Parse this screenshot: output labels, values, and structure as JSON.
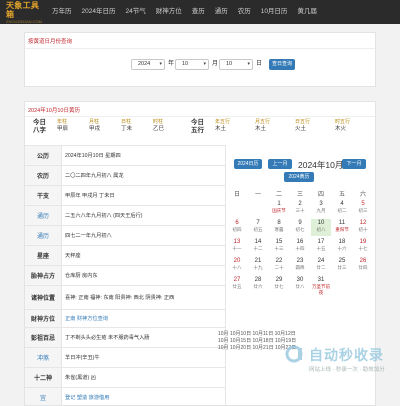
{
  "nav": {
    "logo_title": "天象工具箱",
    "logo_sub": "ZHOUJIEDAN.COM",
    "items": [
      "万年历",
      "2024年日历",
      "24节气",
      "财神方位",
      "查历",
      "通历",
      "农历",
      "10月日历",
      "黄几届"
    ]
  },
  "query": {
    "heading": "按黄道日月份查询",
    "year": "2024",
    "year_unit": "年",
    "month": "10",
    "month_unit": "月",
    "day": "10",
    "day_unit": "日",
    "button": "查日查询"
  },
  "detail": {
    "heading": "2024年10月10日黄历",
    "pillars_label": {
      "top": "今日",
      "bottom": "八字"
    },
    "pillars": [
      {
        "k": "年柱",
        "v": "甲辰"
      },
      {
        "k": "月柱",
        "v": "甲戌"
      },
      {
        "k": "日柱",
        "v": "丁未"
      },
      {
        "k": "时柱",
        "v": "乙巳"
      }
    ],
    "wuxing_label": {
      "top": "今日",
      "bottom": "五行"
    },
    "wuxing": [
      {
        "k": "年五行",
        "v": "木土"
      },
      {
        "k": "月五行",
        "v": "木土"
      },
      {
        "k": "日五行",
        "v": "火土"
      },
      {
        "k": "时五行",
        "v": "木火"
      }
    ],
    "rows": [
      {
        "label": "公历",
        "value": "2024年10月10日 星期四",
        "lab_style": "",
        "val_style": ""
      },
      {
        "label": "农历",
        "value": "二〇二四年九月初八 属龙",
        "lab_style": "",
        "val_style": ""
      },
      {
        "label": "干支",
        "value": "甲辰年 甲戌月 丁未日",
        "lab_style": "",
        "val_style": ""
      },
      {
        "label": "通历",
        "value": "二五六八年九月初八 (四天王后行)",
        "lab_style": "blue",
        "val_style": ""
      },
      {
        "label": "通历",
        "value": "四七二一年九月初八",
        "lab_style": "blue",
        "val_style": ""
      },
      {
        "label": "星座",
        "value": "天秤座",
        "lab_style": "",
        "val_style": ""
      },
      {
        "label": "胎神占方",
        "value": "仓库厨 房内东",
        "lab_style": "",
        "val_style": ""
      },
      {
        "label": "诸神位置",
        "value": "喜神: 正南 福神: 东南 阳贵神: 西北 阴贵神: 正西",
        "lab_style": "",
        "val_style": ""
      },
      {
        "label": "财神方位",
        "value": "正南 财神方位查询",
        "lab_style": "",
        "val_style": "blue"
      },
      {
        "label": "彭祖百忌",
        "value": "丁不剃头头必生疮 未不服药毒气入肠",
        "lab_style": "",
        "val_style": ""
      },
      {
        "label": "冲煞",
        "value": "羊日冲(辛丑)牛",
        "lab_style": "",
        "val_style": ""
      },
      {
        "label": "十二神",
        "value": "朱雀(黑道) 凶",
        "lab_style": "",
        "val_style": ""
      },
      {
        "label": "宜",
        "value": "登记 塑造 旅游借用",
        "lab_style": "blue",
        "val_style": "blue"
      }
    ]
  },
  "calendar": {
    "btn_prev_label": "2024日历",
    "btn_prev_month": "上一月",
    "title": "2024年10月",
    "btn_next_month": "下一月",
    "btn_calendar": "2024黄历",
    "weekdays": [
      "日",
      "一",
      "二",
      "三",
      "四",
      "五",
      "六"
    ],
    "cells": [
      {
        "n": "",
        "l": ""
      },
      {
        "n": "",
        "l": ""
      },
      {
        "n": "1",
        "l": "国庆节"
      },
      {
        "n": "2",
        "l": "三十"
      },
      {
        "n": "3",
        "l": "九月"
      },
      {
        "n": "4",
        "l": "初二"
      },
      {
        "n": "5",
        "l": "初三"
      },
      {
        "n": "6",
        "l": "初四"
      },
      {
        "n": "7",
        "l": "初五"
      },
      {
        "n": "8",
        "l": "寒露"
      },
      {
        "n": "9",
        "l": "初七"
      },
      {
        "n": "10",
        "l": "初八"
      },
      {
        "n": "11",
        "l": "重阳节"
      },
      {
        "n": "12",
        "l": "初十"
      },
      {
        "n": "13",
        "l": "十一"
      },
      {
        "n": "14",
        "l": "十二"
      },
      {
        "n": "15",
        "l": "十三"
      },
      {
        "n": "16",
        "l": "十四"
      },
      {
        "n": "17",
        "l": "十五"
      },
      {
        "n": "18",
        "l": "十六"
      },
      {
        "n": "19",
        "l": "十七"
      },
      {
        "n": "20",
        "l": "十八"
      },
      {
        "n": "21",
        "l": "十九"
      },
      {
        "n": "22",
        "l": "二十"
      },
      {
        "n": "23",
        "l": "霜降"
      },
      {
        "n": "24",
        "l": "廿二"
      },
      {
        "n": "25",
        "l": "廿三"
      },
      {
        "n": "26",
        "l": "廿四"
      },
      {
        "n": "27",
        "l": "廿五"
      },
      {
        "n": "28",
        "l": "廿六"
      },
      {
        "n": "29",
        "l": "廿七"
      },
      {
        "n": "30",
        "l": "廿八"
      },
      {
        "n": "31",
        "l": "万圣节前夜"
      }
    ],
    "festival_days": [
      "1",
      "11",
      "31"
    ],
    "today": "10",
    "recent_list": [
      "10月 10月10日 10月11日 10月12日",
      "10月 10月15日 10月18日 10月19日",
      "10月 10月20日 10月21日 10月22日"
    ]
  },
  "watermark": {
    "main": "自动秒收录",
    "sub": "网站上线 · 秒录一次 · 助效加分"
  }
}
